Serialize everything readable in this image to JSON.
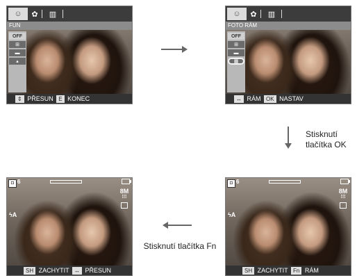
{
  "panel1": {
    "title": "FUN",
    "items": [
      "OFF",
      "⊞",
      "▬",
      "▴"
    ],
    "hints": [
      "⇕",
      "PŘESUN",
      "E",
      "KONEC"
    ]
  },
  "panel2": {
    "title": "FOTO RÁM",
    "items": [
      "OFF",
      "⊞",
      "▬",
      "▦"
    ],
    "hints": [
      "↔",
      "RÁM",
      "OK",
      "NASTAV"
    ]
  },
  "panel3": {
    "count": "6",
    "quality": "8M",
    "flash": "ϟA",
    "hints": [
      "SH",
      "ZACHYTIT",
      "↔",
      "PŘESUN"
    ]
  },
  "panel4": {
    "count": "6",
    "quality": "8M",
    "flash": "ϟA",
    "hints": [
      "SH",
      "ZACHYTIT",
      "Fn",
      "RÁM"
    ]
  },
  "captions": {
    "ok": "Stisknutí tlačítka OK",
    "fn": "Stisknutí tlačítka Fn"
  }
}
